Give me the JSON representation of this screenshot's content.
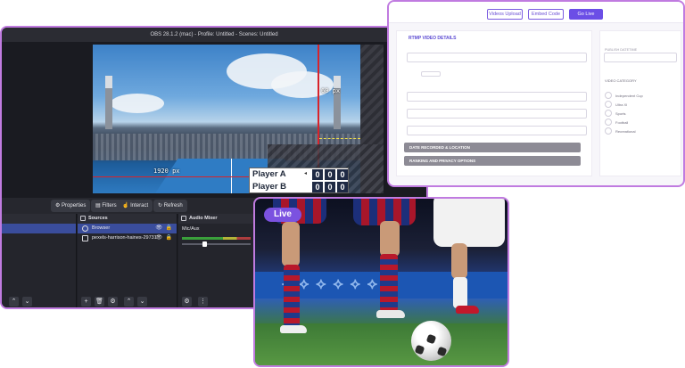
{
  "obs": {
    "window_title": "OBS 28.1.2 (mac) - Profile: Untitled - Scenes: Untitled",
    "preview": {
      "guide_top_label": "60 px",
      "guide_left_label": "1920 px"
    },
    "scoreboard": {
      "rows": [
        {
          "name": "Player A",
          "scores": [
            "0",
            "0",
            "0"
          ]
        },
        {
          "name": "Player B",
          "scores": [
            "0",
            "0",
            "0"
          ]
        }
      ]
    },
    "toolbar": {
      "properties_label": "Properties",
      "filters_label": "Filters",
      "interact_label": "Interact",
      "refresh_label": "Refresh"
    },
    "sources": {
      "title": "Sources",
      "items": [
        {
          "label": "Browser",
          "selected": true
        },
        {
          "label": "pexels-harrison-haines-29731"
        }
      ]
    },
    "audio_mixer": {
      "title": "Audio Mixer",
      "channel_label": "Mic/Aux"
    }
  },
  "form": {
    "top_buttons": {
      "upload": "Videos Upload",
      "embed": "Embed Code",
      "go_live": "Go Live"
    },
    "left": {
      "heading": "RTMP VIDEO DETAILS",
      "section_bars": [
        "DATE RECORDED & LOCATION",
        "RANKING AND PRIVACY OPTIONS"
      ]
    },
    "right": {
      "publish_label": "PUBLISH DATETIME",
      "category_heading": "VIDEO CATEGORY",
      "categories": [
        "Independent Cup",
        "Ultra XI",
        "Sports",
        "Football",
        "Recreational"
      ]
    }
  },
  "live_card": {
    "badge": "Live"
  },
  "colors": {
    "accent_purple": "#c07be0",
    "go_live_button": "#6b4ee6",
    "live_badge": "#7b52e0",
    "obs_bg": "#1e1f26",
    "guide_red": "#d8232a"
  }
}
